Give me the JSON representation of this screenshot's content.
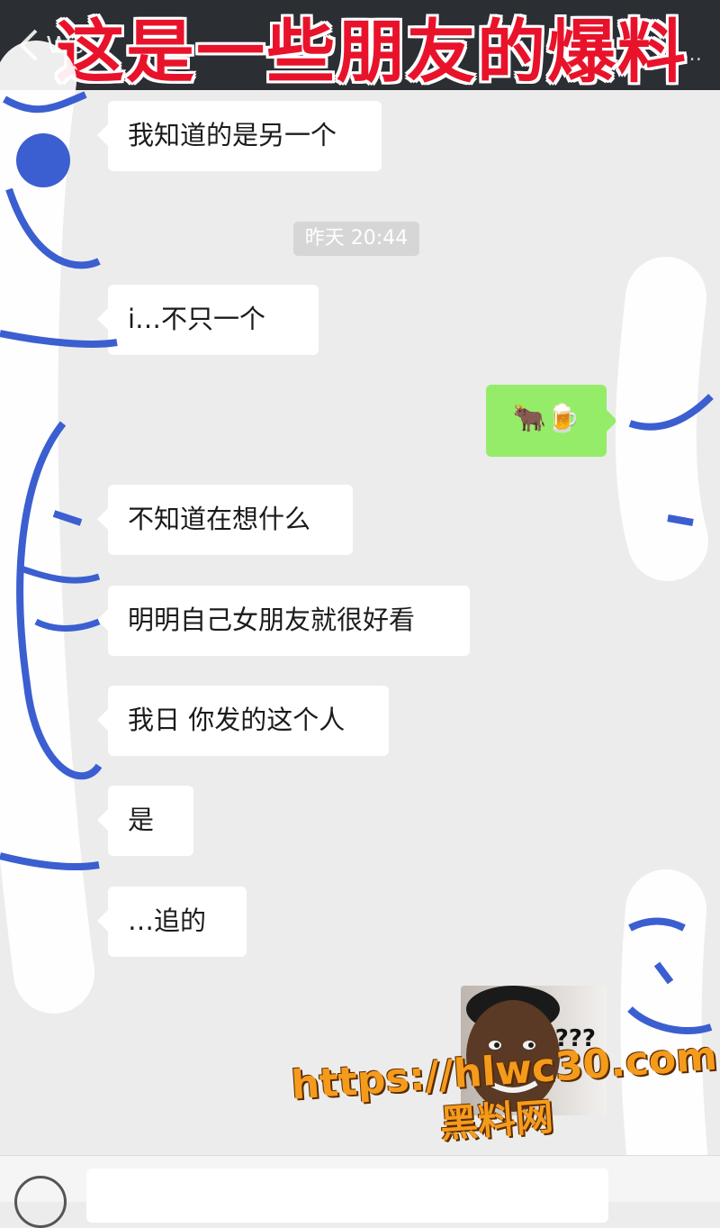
{
  "header": {
    "back_label": "<",
    "chat_title": "We…",
    "more_label": "…",
    "overlay_caption": "这是一些朋友的爆料"
  },
  "timestamp": "昨天 20:44",
  "messages": [
    {
      "side": "left",
      "text": "我知道的是另一个"
    },
    {
      "side": "left",
      "text": "i…不只一个"
    },
    {
      "side": "right",
      "text": "🐂🍺"
    },
    {
      "side": "left",
      "text": "不知道在想什么"
    },
    {
      "side": "left",
      "text": "明明自己女朋友就很好看"
    },
    {
      "side": "left",
      "text": "我日 你发的这个人"
    },
    {
      "side": "left",
      "text": "是"
    },
    {
      "side": "left",
      "text": "…追的"
    }
  ],
  "sticker": {
    "caption": "???"
  },
  "watermark": {
    "url": "https://hlwc30.com",
    "name": "黑料网"
  },
  "colors": {
    "header_bg": "#2b2e33",
    "chat_bg": "#ececec",
    "sent_bubble": "#95ec69",
    "caption_red": "#e8132b",
    "watermark_orange": "#f59b1c",
    "scribble_blue": "#3b5fd0"
  }
}
